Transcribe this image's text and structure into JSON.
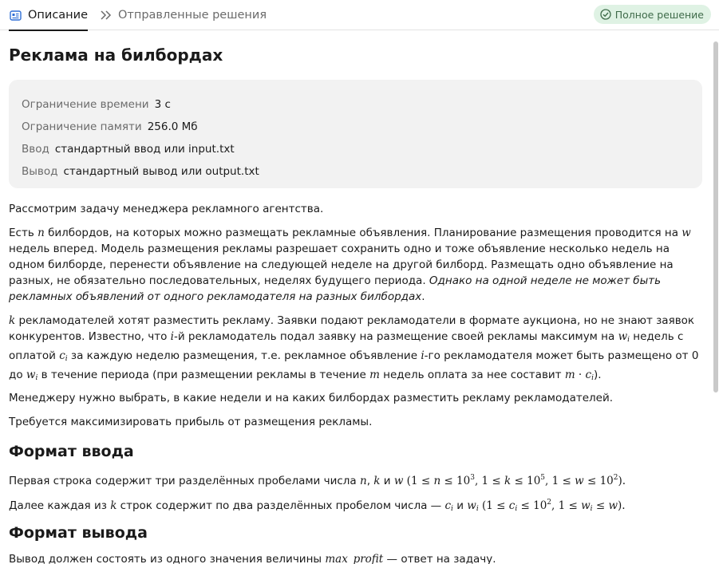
{
  "tabs": {
    "description": "Описание",
    "submissions": "Отправленные решения",
    "status_badge": "Полное решение"
  },
  "problem": {
    "title": "Реклама на билбордах",
    "limits": [
      {
        "key": "Ограничение времени",
        "value": "3 с"
      },
      {
        "key": "Ограничение памяти",
        "value": "256.0 Мб"
      },
      {
        "key": "Ввод",
        "value": "стандартный ввод или input.txt"
      },
      {
        "key": "Вывод",
        "value": "стандартный вывод или output.txt"
      }
    ],
    "p1": "Рассмотрим задачу менеджера рекламного агентства.",
    "p2": {
      "t1": "Есть ",
      "n": "n",
      "t2": " билбордов, на которых можно размещать рекламные объявления. Планирование размещения проводится на ",
      "w": "w",
      "t3": " недель вперед. Модель размещения рекламы разрешает сохранить одно и тоже объявление несколько недель на одном билборде, перенести объявление на следующей неделе на другой билборд. Размещать одно объявление на разных, не обязательно последовательных, неделях будущего периода. ",
      "italic": "Однако на одной неделе не может быть рекламных объявлений от одного рекламодателя на разных билбордах",
      "t4": "."
    },
    "p3": {
      "k": "k",
      "t1": " рекламодателей хотят разместить рекламу. Заявки подают рекламодатели в формате аукциона, но не знают заявок конкурентов. Известно, что ",
      "i": "i",
      "t2": "-й рекламодатель подал заявку на размещение своей рекламы максимум на ",
      "wi": "w",
      "sub_i": "i",
      "t3": " недель с оплатой ",
      "ci": "c",
      "t4": " за каждую неделю размещения, т.е. рекламное объявление ",
      "t5": "-го рекламодателя может быть размещено от 0 до ",
      "t6": " в течение периода (при размещении рекламы в течение ",
      "m": "m",
      "t7": " недель оплата за нее составит ",
      "dot": " · ",
      "t8": ")."
    },
    "p4": "Менеджеру нужно выбрать, в какие недели и на каких билбордах разместить рекламу рекламодателей.",
    "p5": "Требуется максимизировать прибыль от размещения рекламы.",
    "input_format_title": "Формат ввода",
    "in1": {
      "t1": "Первая строка содержит три разделённых пробелами числа ",
      "n": "n",
      "comma": ", ",
      "k": "k",
      "and": " и ",
      "w": "w",
      "c1": " (1 ≤ ",
      "c2": " ≤ 10",
      "e3": "3",
      "c3": ", 1 ≤ ",
      "c4": " ≤ 10",
      "e5": "5",
      "c5": ", 1 ≤ ",
      "c6": " ≤ 10",
      "e2": "2",
      "c7": ")."
    },
    "in2": {
      "t1": "Далее каждая из ",
      "k": "k",
      "t2": " строк содержит по два разделённых пробелом числа — ",
      "c": "c",
      "i": "i",
      "and": " и ",
      "w": "w",
      "r1": " (1 ≤ ",
      "r2": " ≤ 10",
      "e2": "2",
      "r3": ", 1 ≤ ",
      "r4": " ≤ ",
      "r5": ")."
    },
    "output_format_title": "Формат вывода",
    "out1": {
      "t1": "Вывод должен состоять из одного значения величины ",
      "var": "max_profit",
      "t2": " — ответ на задачу."
    }
  },
  "colors": {
    "badge_bg": "#dff2e4",
    "badge_text": "#3f6b4a",
    "limits_bg": "#f2f2f2"
  }
}
